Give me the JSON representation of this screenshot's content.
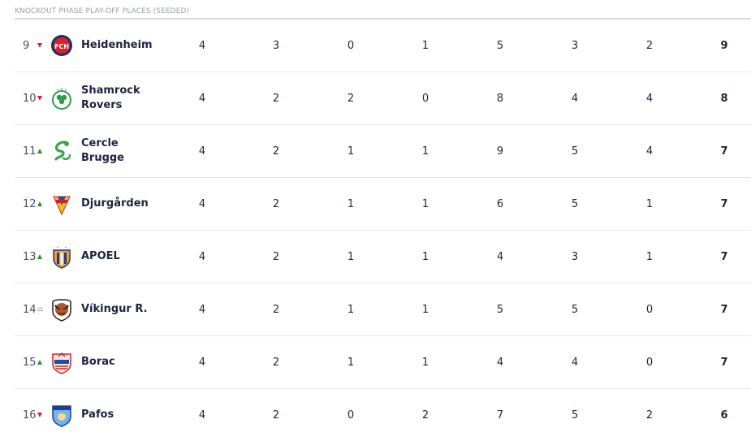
{
  "section": {
    "title": "KNOCKOUT PHASE PLAY-OFF PLACES (SEEDED)"
  },
  "colors": {
    "up": "#2e8b2e",
    "down": "#c8262e",
    "same": "#9aa0a8"
  },
  "rows": [
    {
      "pos": "9",
      "trend": "down",
      "logo": "heidenheim-crest-icon",
      "name": "Heidenheim",
      "stats": [
        "4",
        "3",
        "0",
        "1",
        "5",
        "3",
        "2"
      ],
      "pts": "9"
    },
    {
      "pos": "10",
      "trend": "down",
      "logo": "shamrock-rovers-crest-icon",
      "name": "Shamrock Rovers",
      "stats": [
        "4",
        "2",
        "2",
        "0",
        "8",
        "4",
        "4"
      ],
      "pts": "8"
    },
    {
      "pos": "11",
      "trend": "up",
      "logo": "cercle-brugge-crest-icon",
      "name": "Cercle Brugge",
      "stats": [
        "4",
        "2",
        "1",
        "1",
        "9",
        "5",
        "4"
      ],
      "pts": "7"
    },
    {
      "pos": "12",
      "trend": "up",
      "logo": "djurgarden-crest-icon",
      "name": "Djurgården",
      "stats": [
        "4",
        "2",
        "1",
        "1",
        "6",
        "5",
        "1"
      ],
      "pts": "7"
    },
    {
      "pos": "13",
      "trend": "up",
      "logo": "apoel-crest-icon",
      "name": "APOEL",
      "stats": [
        "4",
        "2",
        "1",
        "1",
        "4",
        "3",
        "1"
      ],
      "pts": "7"
    },
    {
      "pos": "14",
      "trend": "same",
      "logo": "vikingur-crest-icon",
      "name": "Víkingur R.",
      "stats": [
        "4",
        "2",
        "1",
        "1",
        "5",
        "5",
        "0"
      ],
      "pts": "7"
    },
    {
      "pos": "15",
      "trend": "up",
      "logo": "borac-crest-icon",
      "name": "Borac",
      "stats": [
        "4",
        "2",
        "1",
        "1",
        "4",
        "4",
        "0"
      ],
      "pts": "7"
    },
    {
      "pos": "16",
      "trend": "down",
      "logo": "pafos-crest-icon",
      "name": "Pafos",
      "stats": [
        "4",
        "2",
        "0",
        "2",
        "7",
        "5",
        "2"
      ],
      "pts": "6"
    }
  ]
}
